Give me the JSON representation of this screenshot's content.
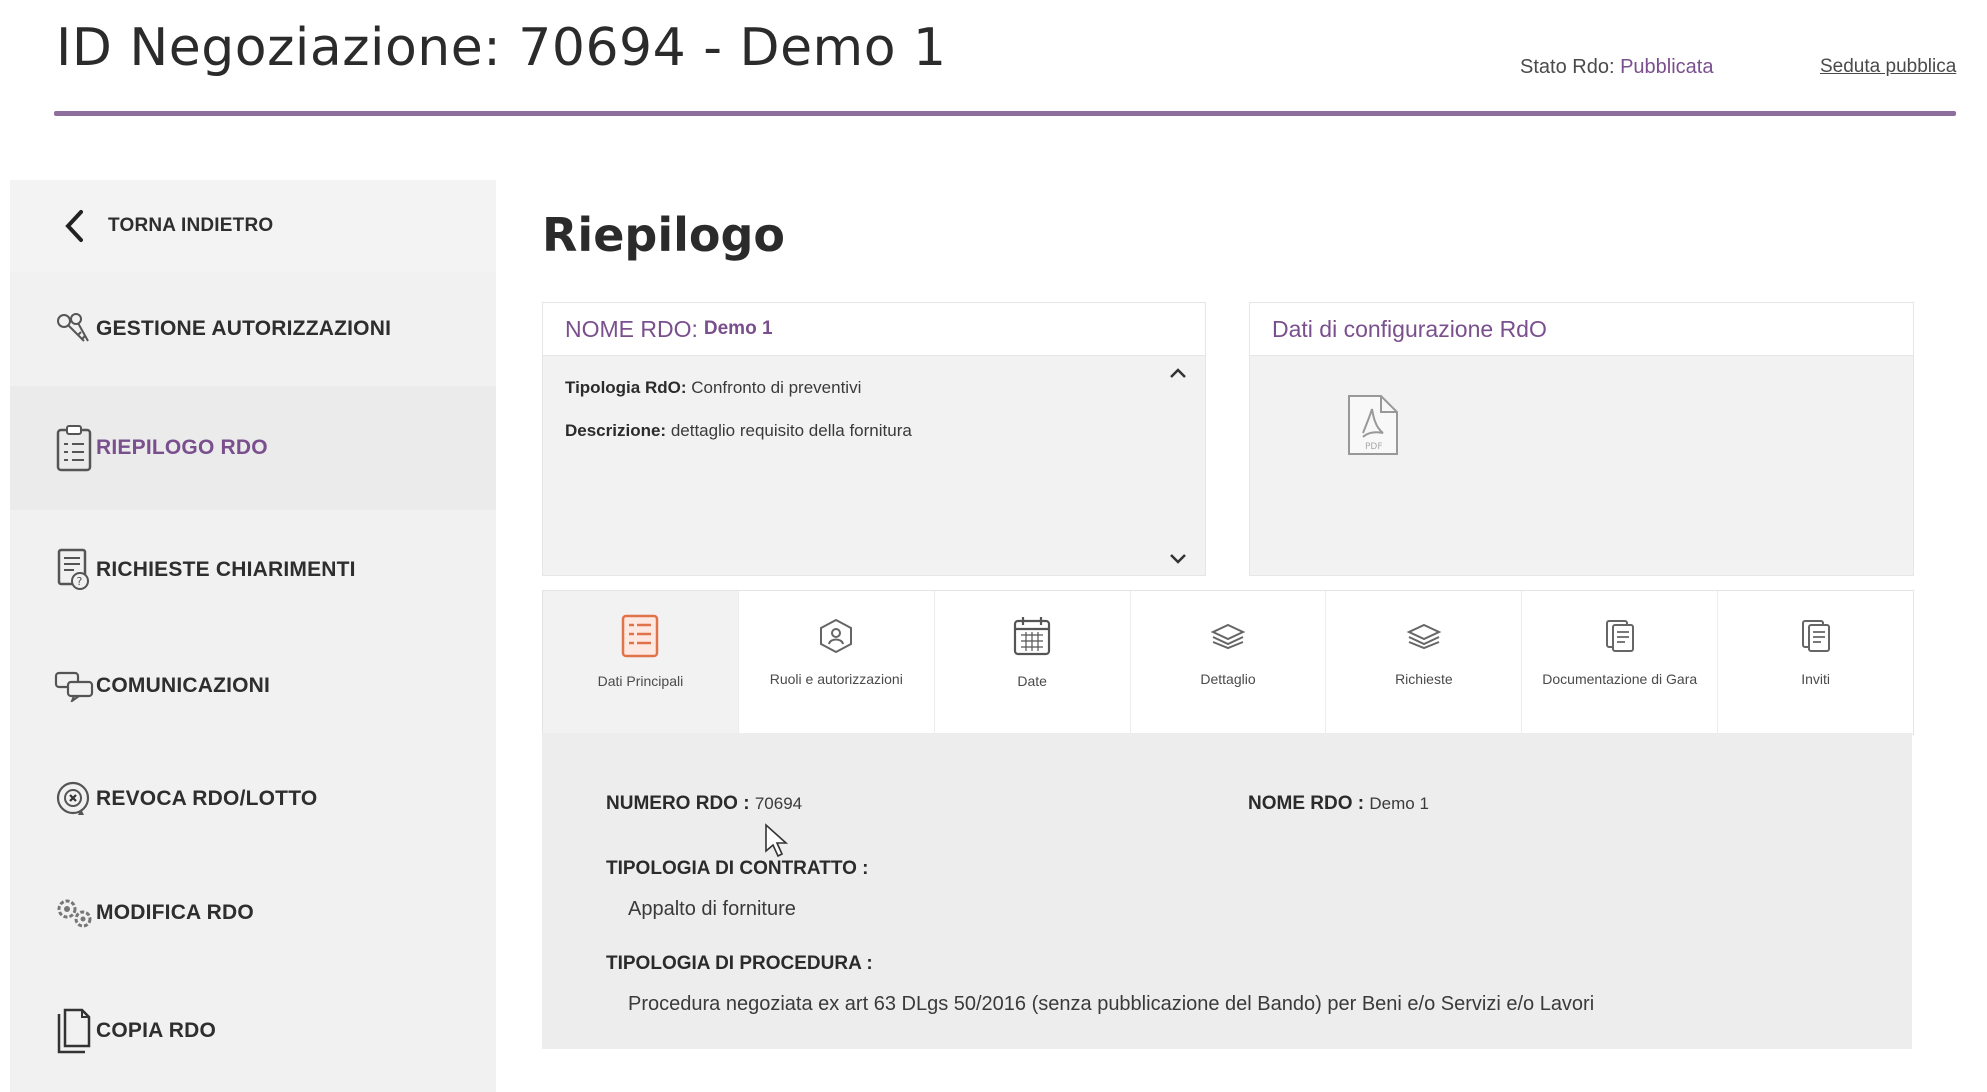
{
  "header": {
    "title": "ID Negoziazione: 70694 - Demo 1",
    "stato_label": "Stato Rdo:",
    "stato_value": "Pubblicata",
    "seduta_link": "Seduta pubblica"
  },
  "sidebar": {
    "back": "TORNA INDIETRO",
    "items": [
      {
        "label": "GESTIONE AUTORIZZAZIONI",
        "icon": "keys-icon"
      },
      {
        "label": "RIEPILOGO RDO",
        "icon": "clipboard-icon",
        "active": true
      },
      {
        "label": "RICHIESTE CHIARIMENTI",
        "icon": "document-question-icon"
      },
      {
        "label": "COMUNICAZIONI",
        "icon": "chat-icon"
      },
      {
        "label": "REVOCA RDO/LOTTO",
        "icon": "revoke-icon"
      },
      {
        "label": "MODIFICA RDO",
        "icon": "gears-icon"
      },
      {
        "label": "COPIA RDO",
        "icon": "copy-icon"
      }
    ]
  },
  "main": {
    "title": "Riepilogo",
    "card_rdo": {
      "head_label": "NOME RDO:",
      "head_value": "Demo 1",
      "tipologia_label": "Tipologia RdO:",
      "tipologia_value": "Confronto di preventivi",
      "descrizione_label": "Descrizione:",
      "descrizione_value": "dettaglio requisito della fornitura"
    },
    "card_config": {
      "head_label": "Dati di configurazione RdO",
      "file_icon": "pdf-icon"
    },
    "tabs": [
      {
        "label": "Dati Principali",
        "icon": "list-icon",
        "active": true
      },
      {
        "label": "Ruoli e autorizzazioni",
        "icon": "roles-icon"
      },
      {
        "label": "Date",
        "icon": "calendar-icon"
      },
      {
        "label": "Dettaglio",
        "icon": "layers-icon"
      },
      {
        "label": "Richieste",
        "icon": "layers-icon"
      },
      {
        "label": "Documentazione di Gara",
        "icon": "docs-icon"
      },
      {
        "label": "Inviti",
        "icon": "docs-icon"
      }
    ],
    "panel": {
      "numero_label": "NUMERO RDO :",
      "numero_value": "70694",
      "nome_label": "NOME RDO :",
      "nome_value": "Demo 1",
      "contratto_label": "TIPOLOGIA DI CONTRATTO :",
      "contratto_value": "Appalto di forniture",
      "procedura_label": "TIPOLOGIA DI PROCEDURA :",
      "procedura_value": "Procedura negoziata ex art 63 DLgs 50/2016 (senza pubblicazione del Bando) per Beni e/o Servizi e/o Lavori"
    }
  },
  "colors": {
    "accent": "#7a4f8d",
    "rule": "#8e6e9c",
    "active_tab_icon": "#e0734a"
  }
}
